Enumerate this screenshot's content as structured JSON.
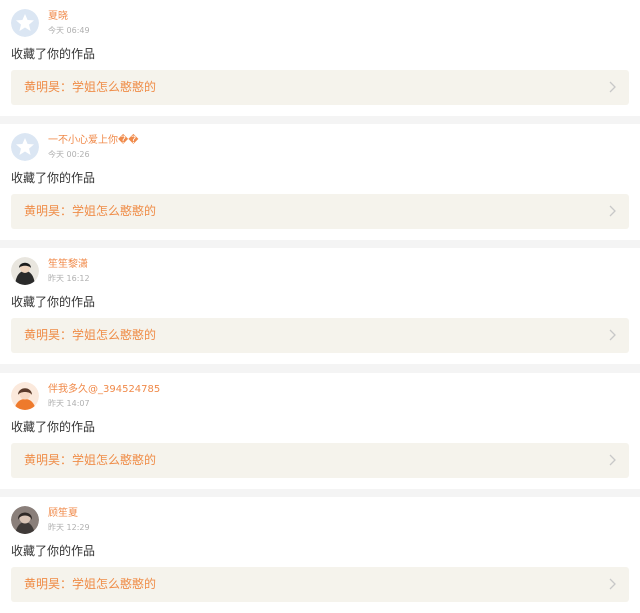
{
  "notifications": [
    {
      "user": "夏晓",
      "time": "今天 06:49",
      "action": "收藏了你的作品",
      "work_title": "黄明昊：学姐怎么憨憨的",
      "avatar_icon": "default-star-avatar-icon"
    },
    {
      "user": "一不小心爱上你��",
      "time": "今天 00:26",
      "action": "收藏了你的作品",
      "work_title": "黄明昊：学姐怎么憨憨的",
      "avatar_icon": "default-star-avatar-icon"
    },
    {
      "user": "笙笙黎潇",
      "time": "昨天 16:12",
      "action": "收藏了你的作品",
      "work_title": "黄明昊：学姐怎么憨憨的",
      "avatar_icon": "photo-avatar-icon"
    },
    {
      "user": "伴我多久@_394524785",
      "time": "昨天 14:07",
      "action": "收藏了你的作品",
      "work_title": "黄明昊：学姐怎么憨憨的",
      "avatar_icon": "photo-avatar-icon"
    },
    {
      "user": "顾笙夏",
      "time": "昨天 12:29",
      "action": "收藏了你的作品",
      "work_title": "黄明昊：学姐怎么憨憨的",
      "avatar_icon": "photo-avatar-icon"
    }
  ],
  "colors": {
    "accent": "#ef8c47",
    "link_background": "#f5f3ec",
    "page_background": "#f4f4f4",
    "card_background": "#ffffff",
    "text": "#333333",
    "time_text": "#b0b0b0"
  }
}
